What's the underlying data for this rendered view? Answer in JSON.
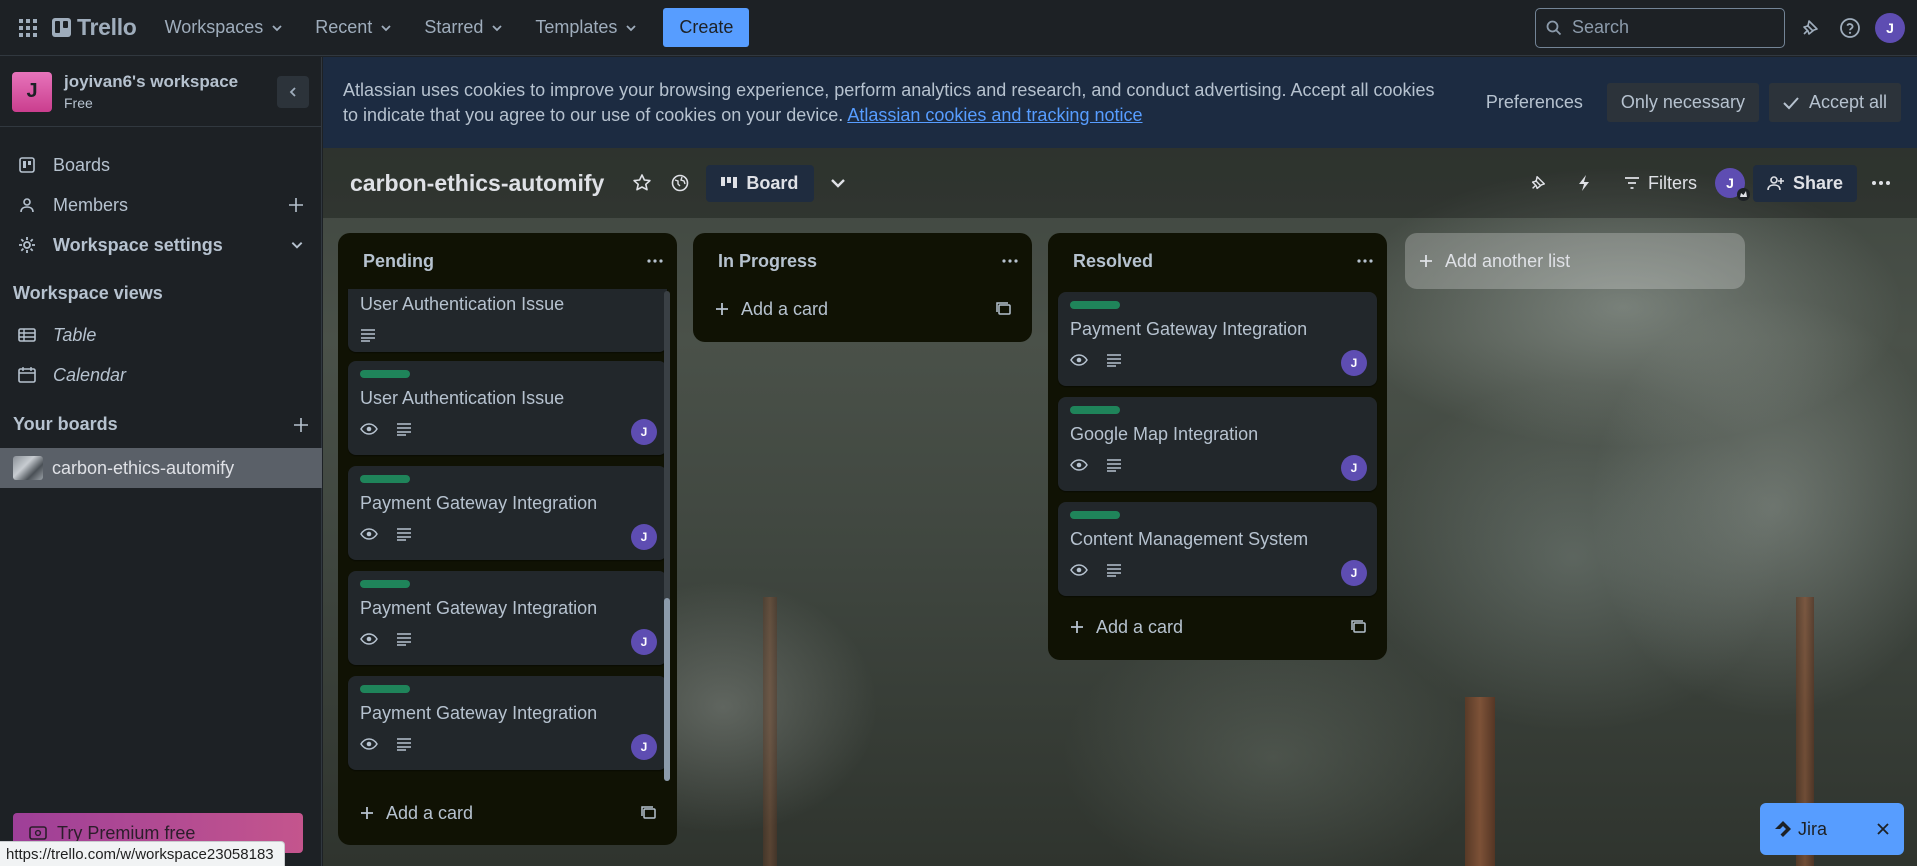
{
  "topbar": {
    "logo": "Trello",
    "nav": [
      "Workspaces",
      "Recent",
      "Starred",
      "Templates"
    ],
    "create_label": "Create",
    "search_placeholder": "Search",
    "user_initial": "J"
  },
  "sidebar": {
    "workspace_initial": "J",
    "workspace_name": "joyivan6's workspace",
    "workspace_plan": "Free",
    "items": [
      {
        "label": "Boards",
        "icon": "trello-board-icon"
      },
      {
        "label": "Members",
        "icon": "person-icon"
      },
      {
        "label": "Workspace settings",
        "icon": "gear-icon"
      }
    ],
    "views_heading": "Workspace views",
    "views": [
      {
        "label": "Table",
        "icon": "table-icon"
      },
      {
        "label": "Calendar",
        "icon": "calendar-icon"
      }
    ],
    "boards_heading": "Your boards",
    "boards": [
      "carbon-ethics-automify"
    ],
    "premium_label": "Try Premium free"
  },
  "cookie_banner": {
    "text": "Atlassian uses cookies to improve your browsing experience, perform analytics and research, and conduct advertising. Accept all cookies to indicate that you agree to our use of cookies on your device.",
    "link": "Atlassian cookies and tracking notice",
    "preferences": "Preferences",
    "only_necessary": "Only necessary",
    "accept_all": "Accept all"
  },
  "board": {
    "title": "carbon-ethics-automify",
    "view_label": "Board",
    "filters_label": "Filters",
    "member_initial": "J",
    "share_label": "Share"
  },
  "lists": [
    {
      "title": "Pending",
      "cards": [
        {
          "title": "User Authentication Issue",
          "label": false,
          "watch": false,
          "avatar": ""
        },
        {
          "title": "User Authentication Issue",
          "label": true,
          "watch": true,
          "avatar": "J"
        },
        {
          "title": "Payment Gateway Integration",
          "label": true,
          "watch": true,
          "avatar": "J"
        },
        {
          "title": "Payment Gateway Integration",
          "label": true,
          "watch": true,
          "avatar": "J"
        },
        {
          "title": "Payment Gateway Integration",
          "label": true,
          "watch": true,
          "avatar": "J"
        }
      ],
      "add_card": "Add a card"
    },
    {
      "title": "In Progress",
      "cards": [],
      "add_card": "Add a card"
    },
    {
      "title": "Resolved",
      "cards": [
        {
          "title": "Payment Gateway Integration",
          "label": true,
          "watch": true,
          "avatar": "J"
        },
        {
          "title": "Google Map Integration",
          "label": true,
          "watch": true,
          "avatar": "J"
        },
        {
          "title": "Content Management System",
          "label": true,
          "watch": true,
          "avatar": "J"
        }
      ],
      "add_card": "Add a card"
    }
  ],
  "add_list_label": "Add another list",
  "jira_label": "Jira",
  "status_url": "https://trello.com/w/workspace23058183",
  "colors": {
    "accent": "#579dff",
    "label_green": "#1f845a",
    "avatar": "#5e4db2"
  }
}
